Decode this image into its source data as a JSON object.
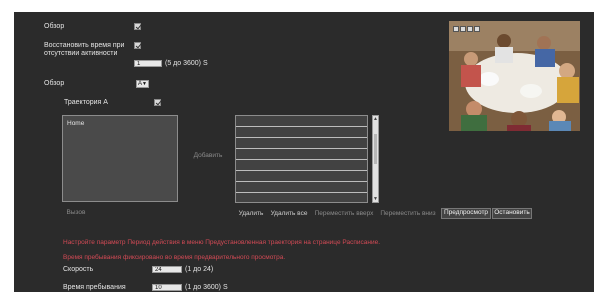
{
  "settings": {
    "overview_label": "Обзор",
    "restore_label_line1": "Восстановить время при",
    "restore_label_line2": "отсутствии активности",
    "restore_value": "1",
    "restore_range": "(5 до 3600) S",
    "overview2_label": "Обзор",
    "overview2_value": "A",
    "trajectory_label": "Траектория A"
  },
  "lists": {
    "available_items": [
      "Home"
    ],
    "add_button": "Добавить",
    "call_button": "Вызов",
    "selected_rows_count": 8
  },
  "actions": {
    "delete": "Удалить",
    "delete_all": "Удалить все",
    "move_up": "Переместить вверх",
    "move_down": "Переместить вниз",
    "preview": "Предпросмотр",
    "stop": "Остановить"
  },
  "notes": {
    "note1": "Настройте параметр Период действия в меню Предустановленная траектория на странице Расписание.",
    "note2": "Время пребывания фиксировано во время предварительного просмотра."
  },
  "speed": {
    "label": "Скорость",
    "value": "24",
    "range": "(1 до 24)"
  },
  "dwell": {
    "label": "Время пребывания",
    "value": "10",
    "range": "(1 до 3600) S"
  },
  "colors": {
    "panel_bg": "#2b2b2b",
    "note_red": "#d24a55"
  }
}
